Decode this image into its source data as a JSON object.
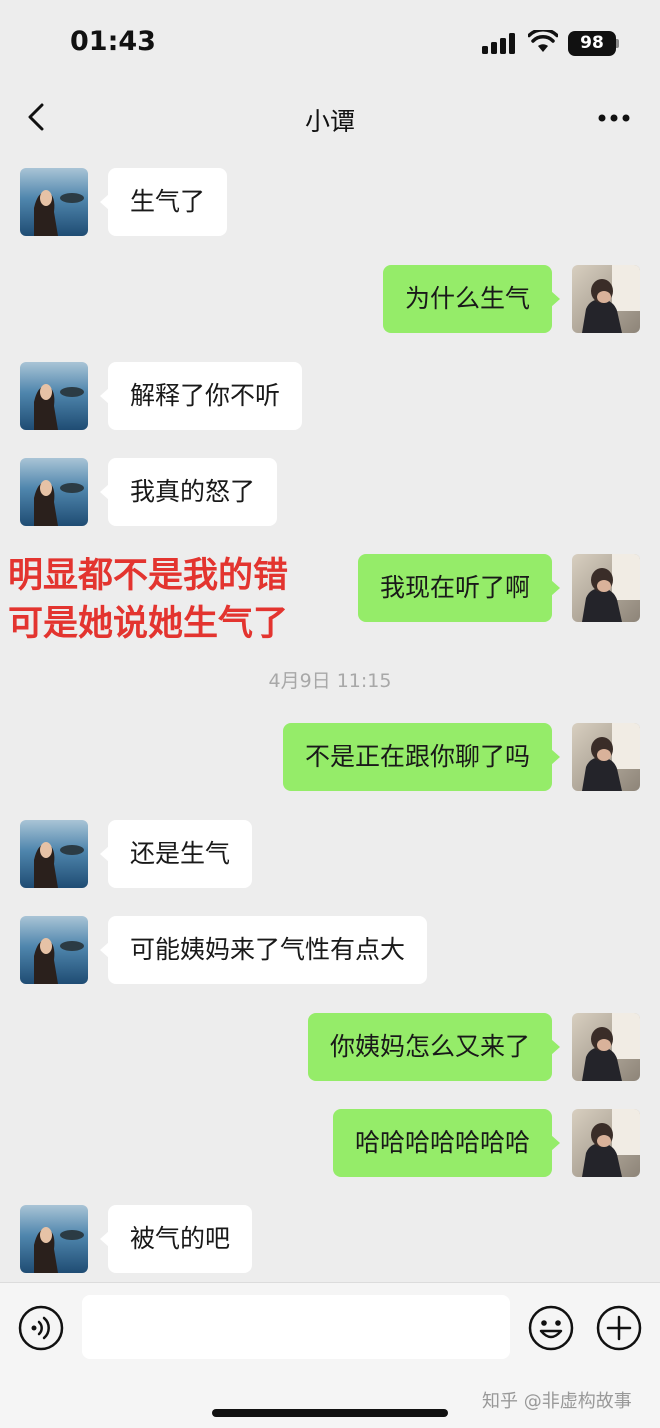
{
  "status_bar": {
    "time": "01:43",
    "battery": "98"
  },
  "nav": {
    "title": "小谭"
  },
  "messages": [
    {
      "side": "left",
      "text": "生气了"
    },
    {
      "side": "right",
      "text": "为什么生气"
    },
    {
      "side": "left",
      "text": "解释了你不听"
    },
    {
      "side": "left",
      "text": "我真的怒了"
    },
    {
      "side": "right",
      "text": "我现在听了啊"
    },
    {
      "side": "right",
      "text": "不是正在跟你聊了吗"
    },
    {
      "side": "left",
      "text": "还是生气"
    },
    {
      "side": "left",
      "text": "可能姨妈来了气性有点大"
    },
    {
      "side": "right",
      "text": "你姨妈怎么又来了"
    },
    {
      "side": "right",
      "text": "哈哈哈哈哈哈哈"
    },
    {
      "side": "left",
      "text": "被气的吧"
    }
  ],
  "timestamp": "4月9日 11:15",
  "overlay": {
    "line1": "明显都不是我的错",
    "line2": "可是她说她生气了",
    "color": "#e3342f"
  },
  "input": {
    "value": ""
  },
  "watermark": "知乎 @非虚构故事",
  "colors": {
    "sent_bubble": "#95ec69",
    "received_bubble": "#ffffff",
    "background": "#ededed"
  }
}
